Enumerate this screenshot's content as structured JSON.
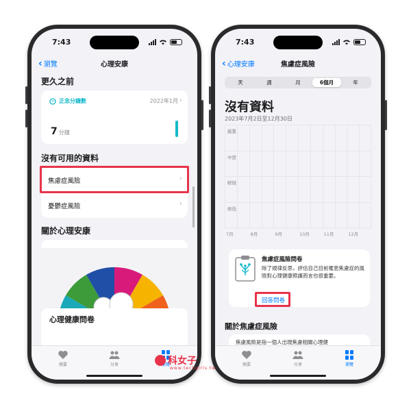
{
  "left_phone": {
    "status": {
      "time": "7:43"
    },
    "nav": {
      "back_label": "瀏覽",
      "title": "心理安康"
    },
    "section_earlier": "更久之前",
    "mindful_card": {
      "title": "正念分鐘數",
      "date": "2022年1月",
      "value": "7",
      "unit": "分鐘"
    },
    "section_no_data": "沒有可用的資料",
    "list_items": [
      {
        "label": "焦慮症風險"
      },
      {
        "label": "憂鬱症風險"
      }
    ],
    "section_about": "關於心理安康",
    "questionnaire_label": "心理健康問卷",
    "tabs": [
      {
        "label": "摘要",
        "icon": "heart-icon"
      },
      {
        "label": "分享",
        "icon": "people-icon"
      },
      {
        "label": "瀏覽",
        "icon": "grid-icon"
      }
    ],
    "active_tab": "瀏覽"
  },
  "right_phone": {
    "status": {
      "time": "7:43"
    },
    "nav": {
      "back_label": "心理安康",
      "title": "焦慮症風險"
    },
    "segments": [
      "天",
      "週",
      "月",
      "6個月",
      "年"
    ],
    "selected_segment": "6個月",
    "headline": "沒有資料",
    "date_range": "2023年7月2日至12月30日",
    "chart_data": {
      "type": "line",
      "categories": [
        "7月",
        "8月",
        "9月",
        "10月",
        "11月",
        "12月"
      ],
      "y_levels": [
        "嚴重",
        "中度",
        "輕微",
        "極低"
      ],
      "series": [],
      "grid": true
    },
    "survey": {
      "title": "焦慮症風險問卷",
      "description": "除了規律反思，評估自己目前罹患焦慮症的風險對心理健康照護而言也很重要。",
      "link": "回答問卷"
    },
    "about_title": "關於焦慮症風險",
    "about_desc": "焦慮風險是指一個人出現焦慮相關心理健",
    "tabs": [
      {
        "label": "摘要",
        "icon": "heart-icon"
      },
      {
        "label": "分享",
        "icon": "people-icon"
      },
      {
        "label": "瀏覽",
        "icon": "grid-icon"
      }
    ]
  },
  "watermark": {
    "text": "科女子",
    "url": "www.techgirls.tw"
  },
  "colors": {
    "accent": "#007aff",
    "highlight": "#e8334a",
    "mindful": "#14b8c9"
  }
}
